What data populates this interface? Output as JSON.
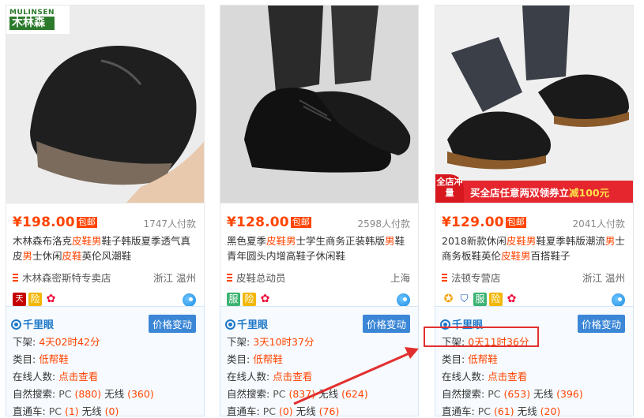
{
  "products": [
    {
      "brand_logo": {
        "en": "MULINSEN",
        "cn": "木林森"
      },
      "price": "¥198.00",
      "baoyou": "包邮",
      "paid": "1747人付款",
      "title": [
        {
          "t": "木林森布洛克",
          "h": false
        },
        {
          "t": "皮鞋男",
          "h": true
        },
        {
          "t": "鞋子韩版夏季透气真皮",
          "h": false
        },
        {
          "t": "男",
          "h": true
        },
        {
          "t": "士休闲",
          "h": false
        },
        {
          "t": "皮鞋",
          "h": true
        },
        {
          "t": "英伦风潮鞋",
          "h": false
        }
      ],
      "shop": "木林森密斯特专卖店",
      "location": "浙江 温州",
      "badges": [
        "tmall",
        "xian",
        "flower"
      ],
      "listing": {
        "label": "下架:",
        "value": "4天02时42分"
      },
      "category": {
        "label": "类目:",
        "value": "低帮鞋"
      },
      "online": {
        "label": "在线人数:",
        "value": "点击查看"
      },
      "natural": {
        "label": "自然搜索:",
        "pc_label": "PC",
        "pc": "(880)",
        "wx_label": "无线",
        "wx": "(360)"
      },
      "ztc": {
        "label": "直通车:",
        "pc_label": "PC",
        "pc": "(1)",
        "wx_label": "无线",
        "wx": "(0)"
      }
    },
    {
      "price": "¥128.00",
      "baoyou": "包邮",
      "paid": "2598人付款",
      "title": [
        {
          "t": "黑色夏季",
          "h": false
        },
        {
          "t": "皮鞋男",
          "h": true
        },
        {
          "t": "士学生商务正装韩版",
          "h": false
        },
        {
          "t": "男",
          "h": true
        },
        {
          "t": "鞋青年圆头内增高鞋子休闲鞋",
          "h": false
        }
      ],
      "shop": "皮鞋总动员",
      "location": "上海",
      "badges": [
        "fu",
        "xian",
        "flower"
      ],
      "listing": {
        "label": "下架:",
        "value": "3天10时37分"
      },
      "category": {
        "label": "类目:",
        "value": "低帮鞋"
      },
      "online": {
        "label": "在线人数:",
        "value": "点击查看"
      },
      "natural": {
        "label": "自然搜索:",
        "pc_label": "PC",
        "pc": "(837)",
        "wx_label": "无线",
        "wx": "(624)"
      },
      "ztc": {
        "label": "直通车:",
        "pc_label": "PC",
        "pc": "(0)",
        "wx_label": "无线",
        "wx": "(76)"
      }
    },
    {
      "promo": {
        "corner": "全店冲量",
        "text": "买全店任意两双领券立",
        "bold": "减100元"
      },
      "price": "¥129.00",
      "baoyou": "包邮",
      "paid": "2041人付款",
      "title": [
        {
          "t": "2018新款休闲",
          "h": false
        },
        {
          "t": "皮鞋男",
          "h": true
        },
        {
          "t": "鞋夏季韩版潮流",
          "h": false
        },
        {
          "t": "男",
          "h": true
        },
        {
          "t": "士商务板鞋英伦",
          "h": false
        },
        {
          "t": "皮鞋男",
          "h": true
        },
        {
          "t": "百搭鞋子",
          "h": false
        }
      ],
      "shop": "法顿专营店",
      "location": "浙江 温州",
      "badges": [
        "medal",
        "shield",
        "fu",
        "xian",
        "flower"
      ],
      "listing": {
        "label": "下架:",
        "value": "0天11时36分"
      },
      "category": {
        "label": "类目:",
        "value": "低帮鞋"
      },
      "online": {
        "label": "在线人数:",
        "value": "点击查看"
      },
      "natural": {
        "label": "自然搜索:",
        "pc_label": "PC",
        "pc": "(653)",
        "wx_label": "无线",
        "wx": "(396)"
      },
      "ztc": {
        "label": "直通车:",
        "pc_label": "PC",
        "pc": "(61)",
        "wx_label": "无线",
        "wx": "(20)"
      }
    }
  ],
  "qianliyan_label": "千里眼",
  "price_change_button": "价格变动",
  "colors": {
    "accent": "#ff4400",
    "link_blue": "#1e78c8",
    "highlight_box": "#e23030"
  }
}
